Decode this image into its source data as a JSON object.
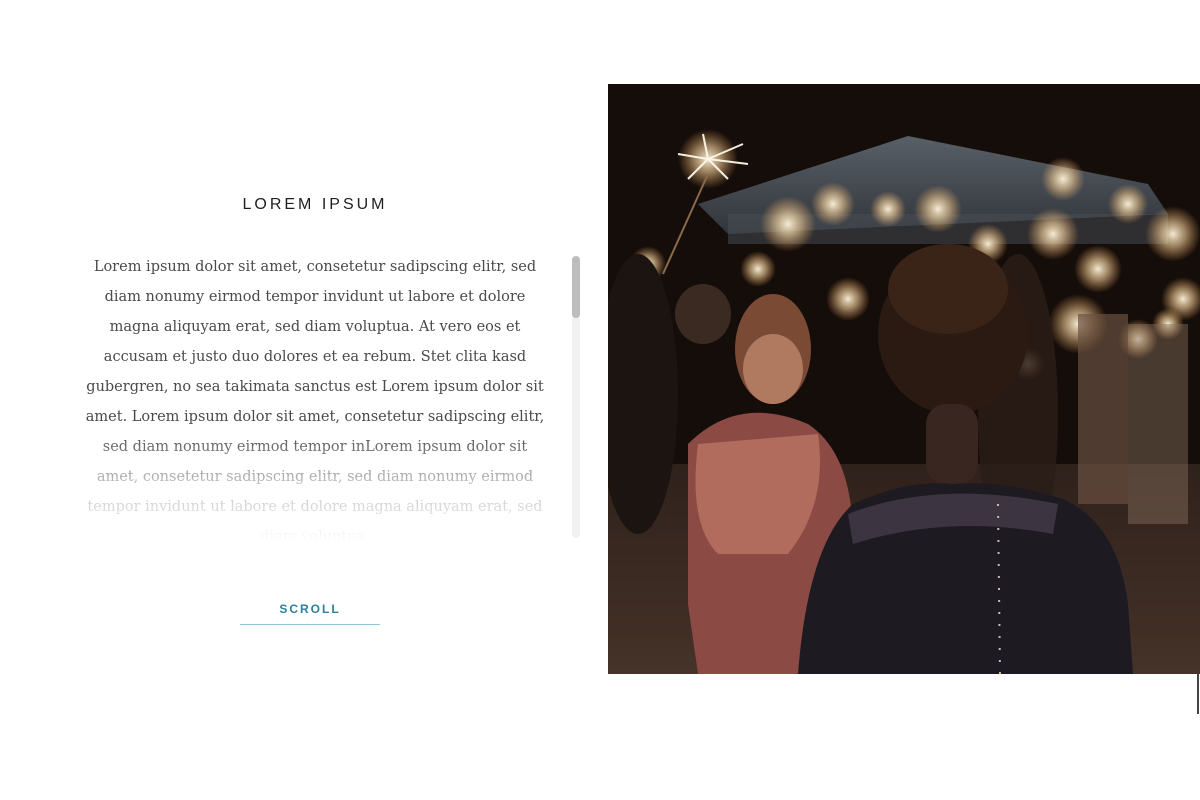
{
  "section": {
    "title": "LOREM IPSUM",
    "body": "Lorem ipsum dolor sit amet, consetetur sadipscing elitr, sed diam nonumy eirmod tempor invidunt ut labore et dolore magna aliquyam erat, sed diam voluptua. At vero eos et accusam et justo duo dolores et ea rebum. Stet clita kasd gubergren, no sea takimata sanctus est Lorem ipsum dolor sit amet. Lorem ipsum dolor sit amet, consetetur sadipscing elitr, sed diam nonumy eirmod tempor inLorem ipsum dolor sit amet, consetetur sadipscing elitr, sed diam nonumy eirmod tempor invidunt ut labore et dolore magna aliquyam erat, sed diam voluptua.",
    "scroll_label": "SCROLL"
  },
  "scroll": {
    "thumb_position": 0
  },
  "photo": {
    "subject": "woman with updo at night sparkler celebration"
  },
  "colors": {
    "title": "#1f1f1f",
    "body_text": "#4a4a4a",
    "accent": "#2f7f9f",
    "accent_underline": "#8fc6da",
    "background": "#ffffff"
  }
}
